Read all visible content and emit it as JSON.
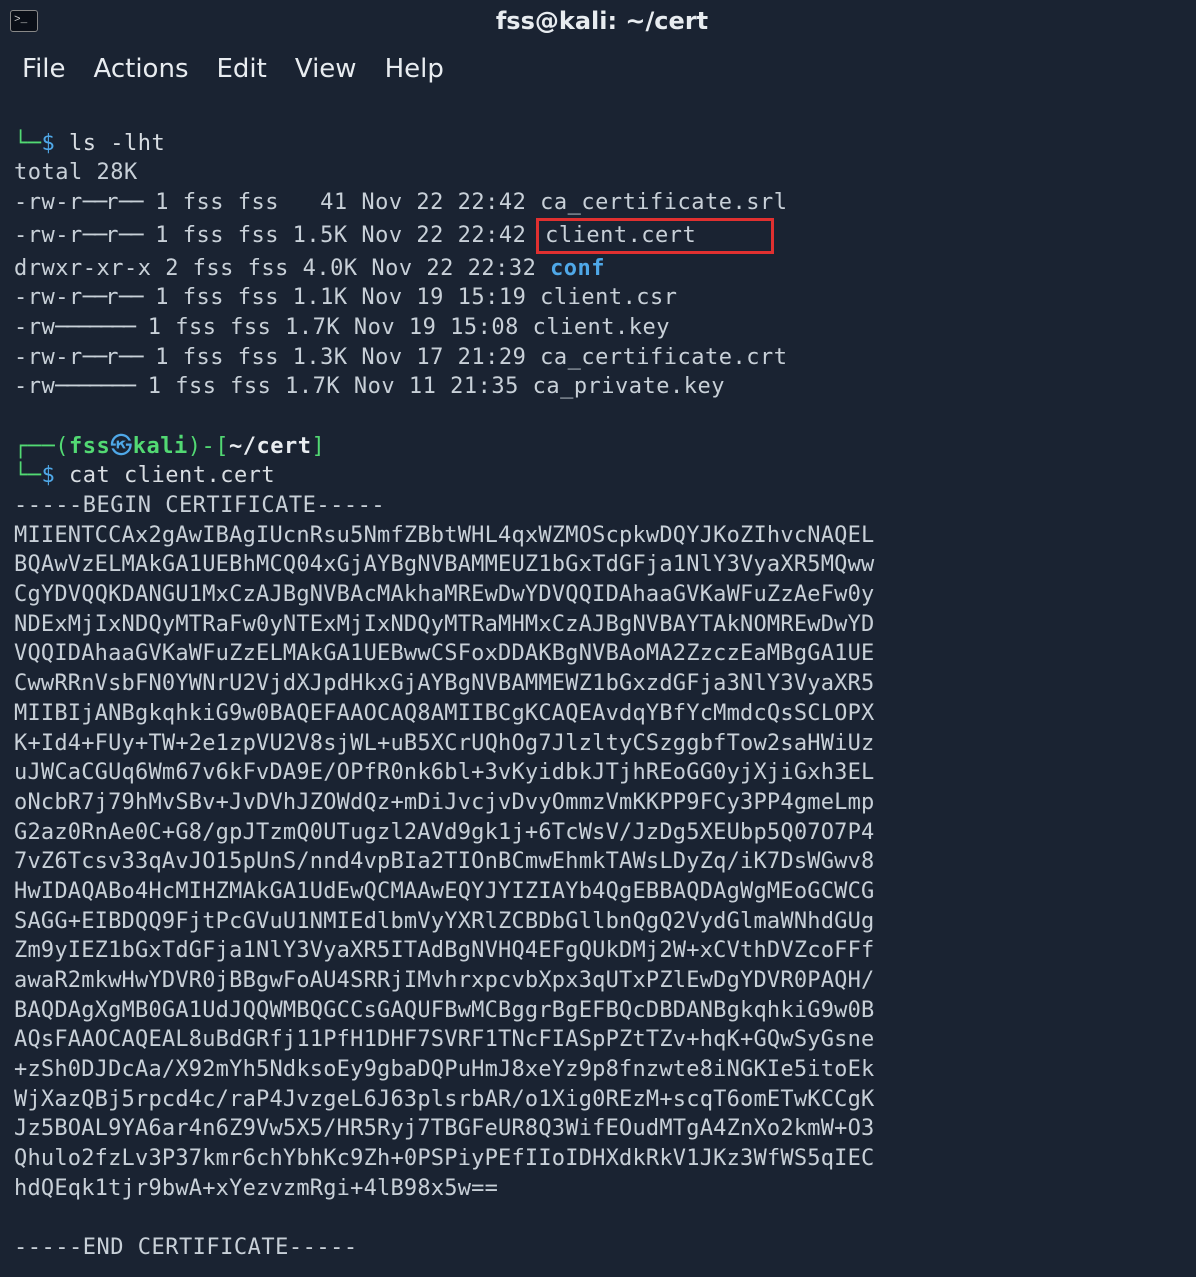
{
  "window": {
    "title": "fss@kali: ~/cert"
  },
  "menu": {
    "file": "File",
    "actions": "Actions",
    "edit": "Edit",
    "view": "View",
    "help": "Help"
  },
  "prompt1": {
    "command": "ls -lht"
  },
  "ls": {
    "total": "total 28K",
    "rows": [
      {
        "perm": "-rw-r--r--",
        "n": "1",
        "u": "fss",
        "g": "fss",
        "size": "  41",
        "date": "Nov 22 22:42",
        "name": "ca_certificate.srl",
        "dir": false,
        "hl": false
      },
      {
        "perm": "-rw-r--r--",
        "n": "1",
        "u": "fss",
        "g": "fss",
        "size": "1.5K",
        "date": "Nov 22 22:42",
        "name": "client.cert",
        "dir": false,
        "hl": true
      },
      {
        "perm": "drwxr-xr-x",
        "n": "2",
        "u": "fss",
        "g": "fss",
        "size": "4.0K",
        "date": "Nov 22 22:32",
        "name": "conf",
        "dir": true,
        "hl": false
      },
      {
        "perm": "-rw-r--r--",
        "n": "1",
        "u": "fss",
        "g": "fss",
        "size": "1.1K",
        "date": "Nov 19 15:19",
        "name": "client.csr",
        "dir": false,
        "hl": false
      },
      {
        "perm": "-rw-------",
        "n": "1",
        "u": "fss",
        "g": "fss",
        "size": "1.7K",
        "date": "Nov 19 15:08",
        "name": "client.key",
        "dir": false,
        "hl": false
      },
      {
        "perm": "-rw-r--r--",
        "n": "1",
        "u": "fss",
        "g": "fss",
        "size": "1.3K",
        "date": "Nov 17 21:29",
        "name": "ca_certificate.crt",
        "dir": false,
        "hl": false
      },
      {
        "perm": "-rw-------",
        "n": "1",
        "u": "fss",
        "g": "fss",
        "size": "1.7K",
        "date": "Nov 11 21:35",
        "name": "ca_private.key",
        "dir": false,
        "hl": false
      }
    ]
  },
  "prompt2": {
    "user": "fss",
    "host": "kali",
    "path": "~/cert",
    "command": "cat client.cert"
  },
  "cert": {
    "begin": "-----BEGIN CERTIFICATE-----",
    "body": "MIIENTCCAx2gAwIBAgIUcnRsu5NmfZBbtWHL4qxWZMOScpkwDQYJKoZIhvcNAQEL\nBQAwVzELMAkGA1UEBhMCQ04xGjAYBgNVBAMMEUZ1bGxTdGFja1NlY3VyaXR5MQww\nCgYDVQQKDANGU1MxCzAJBgNVBAcMAkhaMREwDwYDVQQIDAhaaGVKaWFuZzAeFw0y\nNDExMjIxNDQyMTRaFw0yNTExMjIxNDQyMTRaMHMxCzAJBgNVBAYTAkNOMREwDwYD\nVQQIDAhaaGVKaWFuZzELMAkGA1UEBwwCSFoxDDAKBgNVBAoMA2ZzczEaMBgGA1UE\nCwwRRnVsbFN0YWNrU2VjdXJpdHkxGjAYBgNVBAMMEWZ1bGxzdGFja3NlY3VyaXR5\nMIIBIjANBgkqhkiG9w0BAQEFAAOCAQ8AMIIBCgKCAQEAvdqYBfYcMmdcQsSCLOPX\nK+Id4+FUy+TW+2e1zpVU2V8sjWL+uB5XCrUQhOg7JlzltyCSzggbfTow2saHWiUz\nuJWCaCGUq6Wm67v6kFvDA9E/OPfR0nk6bl+3vKyidbkJTjhREoGG0yjXjiGxh3EL\noNcbR7j79hMvSBv+JvDVhJZOWdQz+mDiJvcjvDvyOmmzVmKKPP9FCy3PP4gmeLmp\nG2az0RnAe0C+G8/gpJTzmQ0UTugzl2AVd9gk1j+6TcWsV/JzDg5XEUbp5Q07O7P4\n7vZ6Tcsv33qAvJO15pUnS/nnd4vpBIa2TIOnBCmwEhmkTAWsLDyZq/iK7DsWGwv8\nHwIDAQABo4HcMIHZMAkGA1UdEwQCMAAwEQYJYIZIAYb4QgEBBAQDAgWgMEoGCWCG\nSAGG+EIBDQQ9FjtPcGVuU1NMIEdlbmVyYXRlZCBDbGllbnQgQ2VydGlmaWNhdGUg\nZm9yIEZ1bGxTdGFja1NlY3VyaXR5ITAdBgNVHQ4EFgQUkDMj2W+xCVthDVZcoFFf\nawaR2mkwHwYDVR0jBBgwFoAU4SRRjIMvhrxpcvbXpx3qUTxPZlEwDgYDVR0PAQH/\nBAQDAgXgMB0GA1UdJQQWMBQGCCsGAQUFBwMCBggrBgEFBQcDBDANBgkqhkiG9w0B\nAQsFAAOCAQEAL8uBdGRfj11PfH1DHF7SVRF1TNcFIASpPZtTZv+hqK+GQwSyGsne\n+zSh0DJDcAa/X92mYh5NdksoEy9gbaDQPuHmJ8xeYz9p8fnzwte8iNGKIe5itoEk\nWjXazQBj5rpcd4c/raP4JvzgeL6J63plsrbAR/o1Xig0REzM+scqT6omETwKCCgK\nJz5BOAL9YA6ar4n6Z9Vw5X5/HR5Ryj7TBGFeUR8Q3WifEOudMTgA4ZnXo2kmW+O3\nQhulo2fzLv3P37kmr6chYbhKc9Zh+0PSPiyPEfIIoIDHXdkRkV1JKz3WfWS5qIEC\nhdQEqk1tjr9bwA+xYezvzmRgi+4lB98x5w==",
    "end": "-----END CERTIFICATE-----"
  }
}
